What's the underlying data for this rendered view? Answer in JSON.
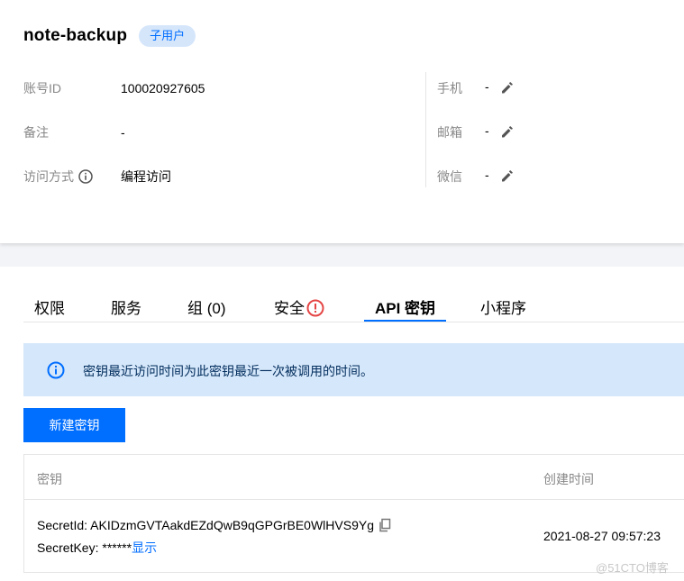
{
  "user": {
    "name": "note-backup",
    "badge": "子用户"
  },
  "info": {
    "account_id_label": "账号ID",
    "account_id_value": "100020927605",
    "remark_label": "备注",
    "remark_value": "-",
    "access_label": "访问方式",
    "access_value": "编程访问",
    "phone_label": "手机",
    "phone_value": "-",
    "email_label": "邮箱",
    "email_value": "-",
    "wechat_label": "微信",
    "wechat_value": "-"
  },
  "tabs": [
    {
      "label": "权限"
    },
    {
      "label": "服务"
    },
    {
      "label": "组 (0)"
    },
    {
      "label": "安全"
    },
    {
      "label": "API 密钥"
    },
    {
      "label": "小程序"
    }
  ],
  "active_tab": "API 密钥",
  "alert": {
    "text": "密钥最近访问时间为此密钥最近一次被调用的时间。"
  },
  "buttons": {
    "new_key": "新建密钥"
  },
  "table": {
    "headers": [
      "密钥",
      "创建时间"
    ],
    "rows": [
      {
        "secret_id_label": "SecretId: ",
        "secret_id": "AKIDzmGVTAakdEZdQwB9qGPGrBE0WlHVS9Yg",
        "secret_key_label": "SecretKey: ",
        "secret_key": "******",
        "show_label": "显示",
        "created": "2021-08-27 09:57:23"
      }
    ]
  },
  "watermark": "@51CTO博客",
  "colors": {
    "accent": "#006eff",
    "alert_bg": "#d5e7fa",
    "badge_bg": "#d5e6fb",
    "warning": "#e54545"
  }
}
